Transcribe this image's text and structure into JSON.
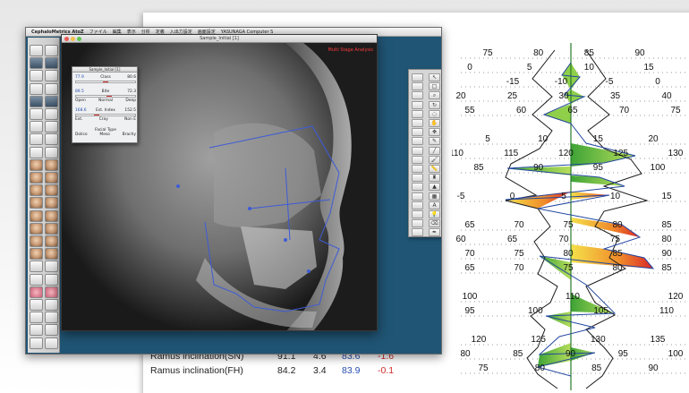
{
  "menubar": {
    "app_name": "CephaloMetrics AtoZ",
    "items": [
      "ファイル",
      "編集",
      "表示",
      "分析",
      "定義",
      "入出力設定",
      "画面設定",
      "YASUNAGA Computer S"
    ]
  },
  "viewer": {
    "title": "Sample_Initial [1]",
    "analysis_tag": "Multi Stage Analysis"
  },
  "panel": {
    "title": "Sample_Initial [1]",
    "rows": [
      {
        "value": "77.9",
        "label": "Class",
        "value2": "80.6"
      },
      {
        "value": "89.5",
        "label": "Bite",
        "value2": "72.3",
        "sub": [
          "Open",
          "Normal",
          "Deep"
        ]
      },
      {
        "value": "168.6",
        "label": "Est. Index",
        "value2": "152.5",
        "sub": [
          "Ext.",
          "Cray",
          "Non E"
        ]
      }
    ],
    "facial_type": {
      "label": "Facial Type",
      "options": [
        "Dolico",
        "Meso",
        "Brachy"
      ]
    },
    "markers": [
      0.45,
      0.52,
      0.3
    ]
  },
  "report": {
    "rows": [
      {
        "label": "Ramus inclination(SN)",
        "v1": "91.1",
        "v2": "4.6",
        "v3": "83.6",
        "v4": "-1.6"
      },
      {
        "label": "Ramus inclination(FH)",
        "v1": "84.2",
        "v2": "3.4",
        "v3": "83.9",
        "v4": "-0.1"
      }
    ]
  },
  "palette_icons": [
    "cursor-icon",
    "rect-select-icon",
    "zoom-icon",
    "rotate-icon",
    "lasso-icon",
    "hand-icon",
    "move-icon",
    "pencil-icon",
    "line-icon",
    "brush-icon",
    "ruler-icon",
    "bottle-icon",
    "triangle-icon",
    "image-icon",
    "text-icon",
    "bulb-icon",
    "eraser-icon",
    "pen-icon"
  ],
  "chart_data": {
    "type": "polygon",
    "tick_rows": [
      [
        "75",
        "80",
        "85",
        "90"
      ],
      [
        "0",
        "5",
        "10",
        "15"
      ],
      [
        "-15",
        "-10",
        "-5",
        "0"
      ],
      [
        "20",
        "25",
        "30",
        "35",
        "40"
      ],
      [
        "55",
        "60",
        "65",
        "70",
        "75"
      ],
      [
        "5",
        "10",
        "15",
        "20"
      ],
      [
        "110",
        "115",
        "120",
        "125",
        "130"
      ],
      [
        "85",
        "90",
        "95",
        "100"
      ],
      [
        "-5",
        "0",
        "5",
        "10",
        "15"
      ],
      [
        "65",
        "70",
        "75",
        "80",
        "85"
      ],
      [
        "60",
        "65",
        "70",
        "75",
        "80"
      ],
      [
        "70",
        "75",
        "80",
        "85",
        "90"
      ],
      [
        "65",
        "70",
        "75",
        "80",
        "85"
      ],
      [
        "100",
        "110",
        "120"
      ],
      [
        "95",
        "100",
        "105",
        "110"
      ],
      [
        "120",
        "125",
        "130",
        "135"
      ],
      [
        "80",
        "85",
        "90",
        "95",
        "100"
      ],
      [
        "75",
        "80",
        "85",
        "90"
      ]
    ]
  }
}
